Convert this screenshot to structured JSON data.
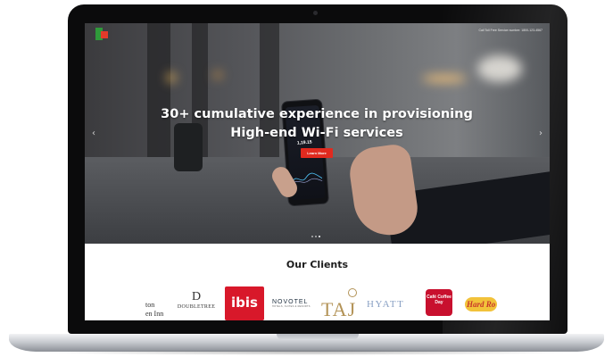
{
  "header": {
    "helpline": "Call Toll Free Service number: 1800-123-4567"
  },
  "hero": {
    "headline": "30+ cumulative experience in provisioning High-end Wi-Fi services",
    "cta_label": "Learn More",
    "phone_value": "1,19.15",
    "prev_arrow": "‹",
    "next_arrow": "›",
    "slides": 3,
    "active_slide": 3
  },
  "clients": {
    "title": "Our Clients",
    "logos": [
      {
        "name": "Hilton Garden Inn",
        "text": "ton\nen Inn"
      },
      {
        "name": "DoubleTree",
        "mark": "D",
        "text": "DOUBLETREE"
      },
      {
        "name": "ibis",
        "text": "ibis"
      },
      {
        "name": "Novotel",
        "text": "NOVOTEL",
        "sub": "HOTELS, SUITES & RESORTS"
      },
      {
        "name": "Taj",
        "text": "TAJ"
      },
      {
        "name": "Hyatt",
        "text": "HYATT"
      },
      {
        "name": "Cafe Coffee Day",
        "text": "Café Coffee Day"
      },
      {
        "name": "Hard Rock",
        "text": "Hard Ro"
      }
    ]
  },
  "colors": {
    "accent_red": "#e12a1f",
    "ibis_red": "#d8182a",
    "taj_gold": "#b39357",
    "hyatt_blue": "#8aa1c4"
  }
}
